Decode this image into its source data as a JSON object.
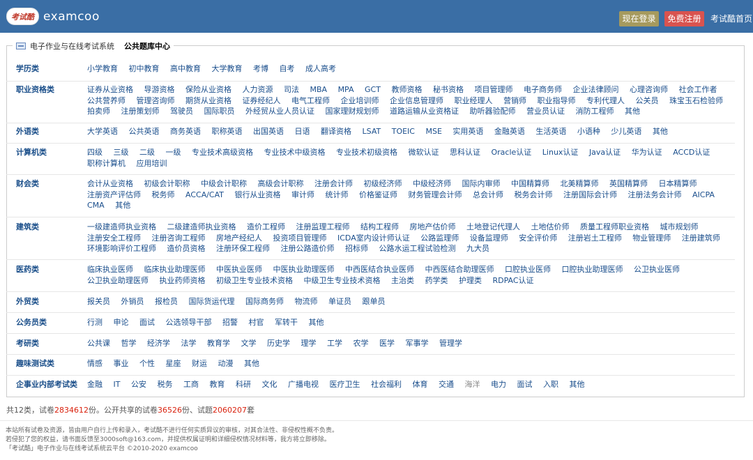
{
  "header": {
    "logo_badge": "考试酷",
    "logo_text": "examcoo",
    "login_label": "现在登录",
    "register_label": "免费注册",
    "home_label": "考试酷首页"
  },
  "legend": {
    "system": "电子作业与在线考试系统",
    "center": "公共题库中心"
  },
  "categories": [
    {
      "name": "学历类",
      "items": [
        "小学教育",
        "初中教育",
        "高中教育",
        "大学教育",
        "考博",
        "自考",
        "成人高考"
      ]
    },
    {
      "name": "职业资格类",
      "items": [
        "证券从业资格",
        "导游资格",
        "保险从业资格",
        "人力资源",
        "司法",
        "MBA",
        "MPA",
        "GCT",
        "教师资格",
        "秘书资格",
        "项目管理师",
        "电子商务师",
        "企业法律顾问",
        "心理咨询师",
        "社会工作者",
        "公共营养师",
        "管理咨询师",
        "期货从业资格",
        "证券经纪人",
        "电气工程师",
        "企业培训师",
        "企业信息管理师",
        "职业经理人",
        "营销师",
        "职业指导师",
        "专利代理人",
        "公关员",
        "珠宝玉石检验师",
        "拍卖师",
        "注册策划师",
        "驾驶员",
        "国际职员",
        "外经贸从业人员认证",
        "国家理财规划师",
        "道路运输从业资格证",
        "助听器验配师",
        "营业员认证",
        "消防工程师",
        "其他"
      ]
    },
    {
      "name": "外语类",
      "items": [
        "大学英语",
        "公共英语",
        "商务英语",
        "职称英语",
        "出国英语",
        "日语",
        "翻译资格",
        "LSAT",
        "TOEIC",
        "MSE",
        "实用英语",
        "金融英语",
        "生活英语",
        "小语种",
        "少儿英语",
        "其他"
      ]
    },
    {
      "name": "计算机类",
      "items": [
        "四级",
        "三级",
        "二级",
        "一级",
        "专业技术高级资格",
        "专业技术中级资格",
        "专业技术初级资格",
        "微软认证",
        "思科认证",
        "Oracle认证",
        "Linux认证",
        "Java认证",
        "华为认证",
        "ACCD认证",
        "职称计算机",
        "应用培训"
      ]
    },
    {
      "name": "财会类",
      "items": [
        "会计从业资格",
        "初级会计职称",
        "中级会计职称",
        "高级会计职称",
        "注册会计师",
        "初级经济师",
        "中级经济师",
        "国际内审师",
        "中国精算师",
        "北美精算师",
        "英国精算师",
        "日本精算师",
        "注册资产评估师",
        "税务师",
        "ACCA/CAT",
        "银行从业资格",
        "审计师",
        "统计师",
        "价格鉴证师",
        "财务管理会计师",
        "总会计师",
        "税务会计师",
        "注册国际会计师",
        "注册法务会计师",
        "AICPA",
        "CMA",
        "其他"
      ]
    },
    {
      "name": "建筑类",
      "items": [
        "一级建造师执业资格",
        "二级建造师执业资格",
        "造价工程师",
        "注册监理工程师",
        "结构工程师",
        "房地产估价师",
        "土地登记代理人",
        "土地估价师",
        "质量工程师职业资格",
        "城市规划师",
        "注册安全工程师",
        "注册咨询工程师",
        "房地产经纪人",
        "投资项目管理师",
        "ICDA室内设计师认证",
        "公路监理师",
        "设备监理师",
        "安全评价师",
        "注册岩土工程师",
        "物业管理师",
        "注册建筑师",
        "环境影响评价工程师",
        "造价员资格",
        "注册环保工程师",
        "注册公路造价师",
        "招标师",
        "公路水运工程试验检测",
        "九大员"
      ]
    },
    {
      "name": "医药类",
      "items": [
        "临床执业医师",
        "临床执业助理医师",
        "中医执业医师",
        "中医执业助理医师",
        "中西医结合执业医师",
        "中西医结合助理医师",
        "口腔执业医师",
        "口腔执业助理医师",
        "公卫执业医师",
        "公卫执业助理医师",
        "执业药师资格",
        "初级卫生专业技术资格",
        "中级卫生专业技术资格",
        "主治类",
        "药学类",
        "护理类",
        "RDPAC认证"
      ]
    },
    {
      "name": "外贸类",
      "items": [
        "报关员",
        "外销员",
        "报检员",
        "国际货运代理",
        "国际商务师",
        "物流师",
        "单证员",
        "跟单员"
      ]
    },
    {
      "name": "公务员类",
      "items": [
        "行测",
        "申论",
        "面试",
        "公选领导干部",
        "招警",
        "村官",
        "军转干",
        "其他"
      ]
    },
    {
      "name": "考研类",
      "items": [
        "公共课",
        "哲学",
        "经济学",
        "法学",
        "教育学",
        "文学",
        "历史学",
        "理学",
        "工学",
        "农学",
        "医学",
        "军事学",
        "管理学"
      ]
    },
    {
      "name": "趣味测试类",
      "items": [
        "情感",
        "事业",
        "个性",
        "星座",
        "财运",
        "动漫",
        "其他"
      ]
    },
    {
      "name": "企事业内部考试类",
      "items": [
        "金融",
        "IT",
        "公安",
        "税务",
        "工商",
        "教育",
        "科研",
        "文化",
        "广播电视",
        "医疗卫生",
        "社会福利",
        "体育",
        "交通",
        "海洋",
        "电力",
        "面试",
        "入职",
        "其他"
      ]
    }
  ],
  "stats": {
    "prefix": "共12类，试卷",
    "papers": "2834612",
    "mid": "份。公开共享的试卷",
    "shared": "36526",
    "mid2": "份、试题",
    "questions": "2060207",
    "suffix": "套"
  },
  "footer": {
    "line1": "本站所有试卷及资源，皆由用户自行上传和录入，考试酷不进行任何实质异议的审核，对其合法性、非侵权性概不负责。",
    "line2": "若侵犯了您的权益，请书面反馈至3000soft@163.com，并提供权属证明和详细侵权情况材料等，我方将立即移除。",
    "line3": "「考试酷」电子作业与在线考试系统云平台    ©2010-2020 examcoo"
  }
}
